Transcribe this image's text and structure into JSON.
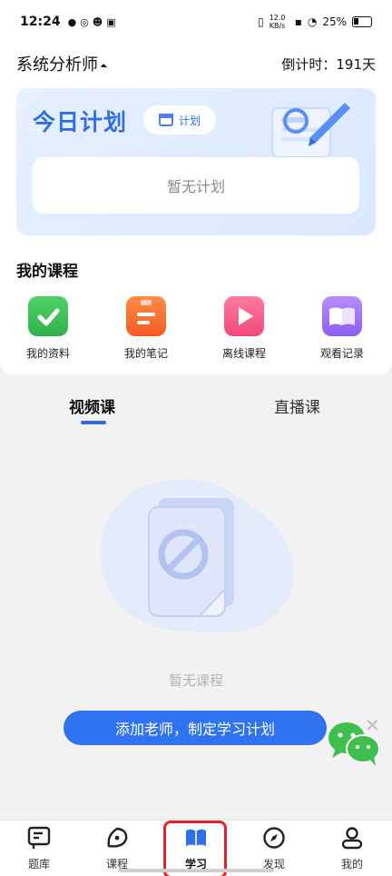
{
  "status": {
    "time": "12:24",
    "net_speed": "12.0 KB/s",
    "battery": "25%"
  },
  "header": {
    "subject": "系统分析师",
    "countdown": "倒计时：191天"
  },
  "plan": {
    "title": "今日计划",
    "button_label": "计划",
    "empty": "暂无计划"
  },
  "my_courses": {
    "title": "我的课程",
    "items": [
      {
        "label": "我的资料",
        "icon": "check-document-icon",
        "color": "#2fb24a"
      },
      {
        "label": "我的笔记",
        "icon": "notes-icon",
        "color": "#f25a20"
      },
      {
        "label": "离线课程",
        "icon": "video-play-icon",
        "color": "#f04a7a"
      },
      {
        "label": "观看记录",
        "icon": "open-book-icon",
        "color": "#8b5ef0"
      }
    ]
  },
  "tabs": {
    "video": "视频课",
    "live": "直播课"
  },
  "empty_courses": "暂无课程",
  "cta": {
    "label": "添加老师，制定学习计划"
  },
  "bottom_nav": {
    "items": [
      {
        "label": "题库",
        "icon": "question-bank-icon"
      },
      {
        "label": "课程",
        "icon": "course-icon"
      },
      {
        "label": "学习",
        "icon": "study-book-icon",
        "active": true
      },
      {
        "label": "发现",
        "icon": "compass-icon"
      },
      {
        "label": "我的",
        "icon": "profile-icon"
      }
    ]
  },
  "colors": {
    "accent": "#2f6ee6",
    "active_highlight": "#e5222a"
  }
}
